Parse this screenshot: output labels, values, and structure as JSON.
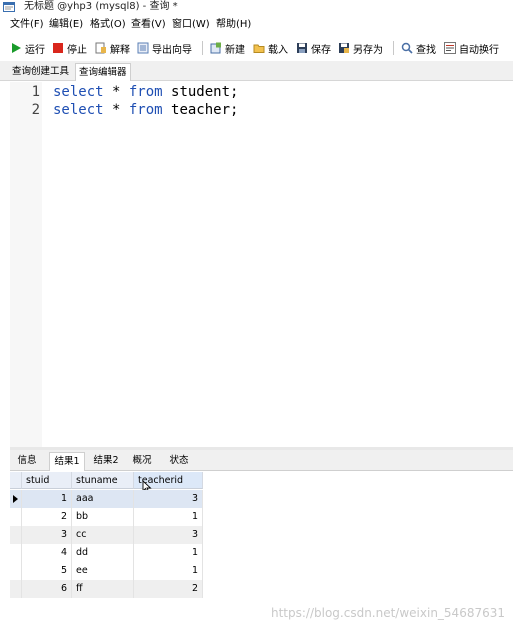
{
  "window": {
    "title": "无标题 @yhp3 (mysql8) - 查询 *"
  },
  "menu": [
    {
      "label": "文件(F)"
    },
    {
      "label": "编辑(E)"
    },
    {
      "label": "格式(O)"
    },
    {
      "label": "查看(V)"
    },
    {
      "label": "窗口(W)"
    },
    {
      "label": "帮助(H)"
    }
  ],
  "toolbar": {
    "run": "运行",
    "stop": "停止",
    "explain": "解释",
    "export_wizard": "导出向导",
    "new": "新建",
    "load": "载入",
    "save": "保存",
    "save_as": "另存为",
    "find": "查找",
    "word_wrap": "自动换行"
  },
  "colors": {
    "accent": "#1f4fb3",
    "stop_red": "#d9261c",
    "run_green": "#1a9b2b"
  },
  "query_tabs": [
    {
      "label": "查询创建工具"
    },
    {
      "label": "查询编辑器"
    }
  ],
  "editor": {
    "lines": [
      {
        "num": "1",
        "kw1": "select",
        "mid": " * ",
        "kw2": "from",
        "rest": " student;"
      },
      {
        "num": "2",
        "kw1": "select",
        "mid": " * ",
        "kw2": "from",
        "rest": " teacher;"
      }
    ]
  },
  "result_tabs": [
    {
      "label": "信息"
    },
    {
      "label": "结果1"
    },
    {
      "label": "结果2"
    },
    {
      "label": "概况"
    },
    {
      "label": "状态"
    }
  ],
  "grid": {
    "columns": [
      "stuid",
      "stuname",
      "teacherid"
    ],
    "rows": [
      {
        "stuid": "1",
        "stuname": "aaa",
        "teacherid": "3"
      },
      {
        "stuid": "2",
        "stuname": "bb",
        "teacherid": "1"
      },
      {
        "stuid": "3",
        "stuname": "cc",
        "teacherid": "3"
      },
      {
        "stuid": "4",
        "stuname": "dd",
        "teacherid": "1"
      },
      {
        "stuid": "5",
        "stuname": "ee",
        "teacherid": "1"
      },
      {
        "stuid": "6",
        "stuname": "ff",
        "teacherid": "2"
      }
    ]
  },
  "watermark": "https://blog.csdn.net/weixin_54687631"
}
